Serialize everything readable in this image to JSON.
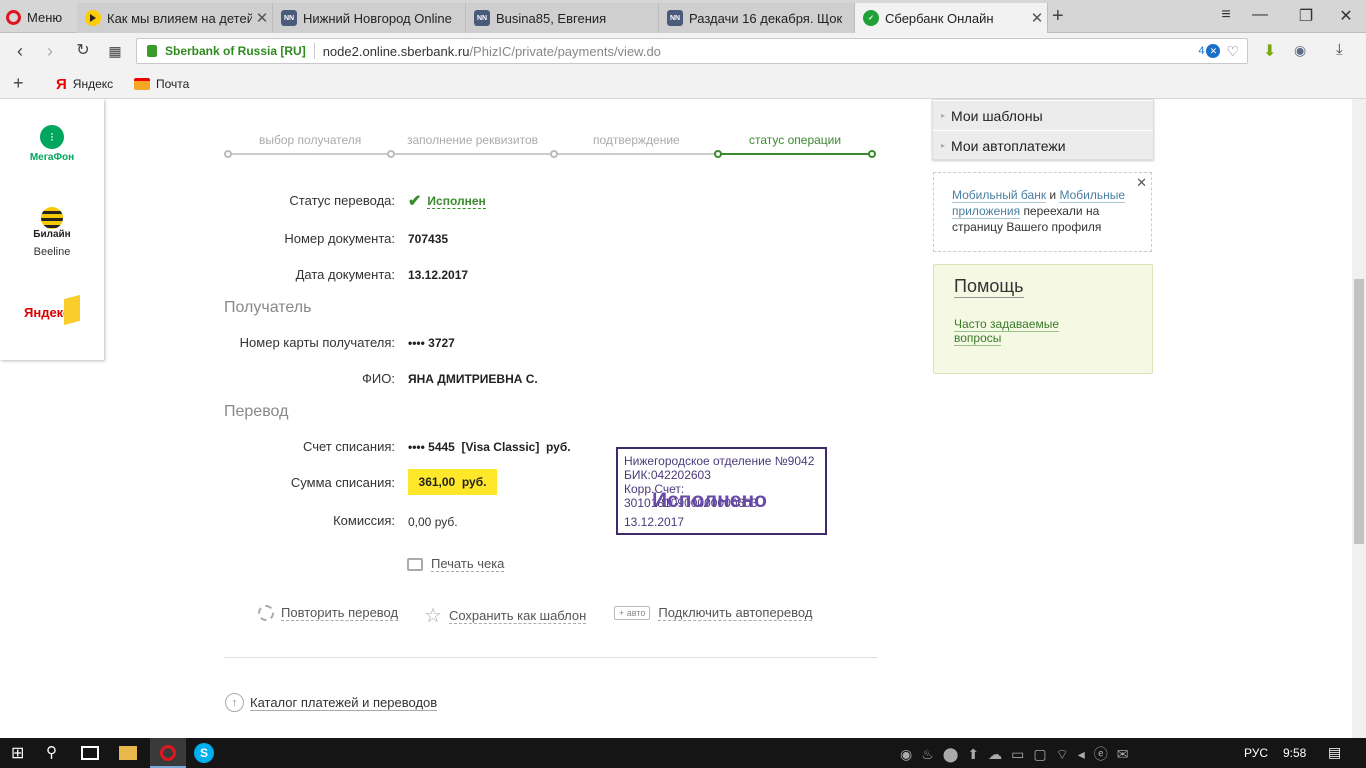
{
  "browser": {
    "menu_label": "Меню",
    "tabs": [
      {
        "title": "Как мы влияем на детей.",
        "favicon": "youtube-icon"
      },
      {
        "title": "Нижний Новгород Online",
        "favicon": "nn-icon"
      },
      {
        "title": "Busina85, Евгения",
        "favicon": "nn-icon"
      },
      {
        "title": "Раздачи 16 декабря. Щок",
        "favicon": "nn-icon"
      },
      {
        "title": "Сбербанк Онлайн",
        "favicon": "sberbank-icon"
      }
    ],
    "security_label": "Sberbank of Russia [RU]",
    "url_host": "node2.online.sberbank.ru",
    "url_path": "/PhizIC/private/payments/view.do",
    "tracker_count": "4",
    "bookmarks": [
      {
        "label": "Яндекс",
        "icon": "yandex-icon"
      },
      {
        "label": "Почта",
        "icon": "mail-icon"
      }
    ]
  },
  "sidebar": {
    "providers": [
      {
        "name": "МегаФон",
        "logo_text": "МегаФон",
        "color": "#00a65e"
      },
      {
        "name": "Beeline",
        "logo_text": "Билайн",
        "color": "#f7c800"
      },
      {
        "name": "Яндекс",
        "logo_text": "Яндекс",
        "color": "#f8cd2c"
      }
    ]
  },
  "steps": [
    {
      "label": "выбор получателя",
      "state": "done"
    },
    {
      "label": "заполнение реквизитов",
      "state": "done"
    },
    {
      "label": "подтверждение",
      "state": "done"
    },
    {
      "label": "статус операции",
      "state": "current"
    }
  ],
  "operation": {
    "status_label": "Статус перевода:",
    "status_value": "Исполнен",
    "doc_number_label": "Номер документа:",
    "doc_number": "707435",
    "doc_date_label": "Дата документа:",
    "doc_date": "13.12.2017",
    "recipient_header": "Получатель",
    "card_label": "Номер карты получателя:",
    "card_value": "•••• 3727",
    "fio_label": "ФИО:",
    "fio_value": "ЯНА ДМИТРИЕВНА С.",
    "transfer_header": "Перевод",
    "account_label": "Счет списания:",
    "account_value": "•••• 5445  [Visa Classic]  руб.",
    "amount_label": "Сумма списания:",
    "amount_value": "361,00  руб.",
    "fee_label": "Комиссия:",
    "fee_value": "0,00 руб.",
    "print_label": "Печать чека"
  },
  "stamp": {
    "line1": "Нижегородское отделение №9042",
    "line2": "БИК:042202603",
    "line3": "Корр.Счет: 30101810900000000603",
    "status": "Исполнено",
    "date": "13.12.2017"
  },
  "actions": {
    "repeat": "Повторить перевод",
    "save_template": "Сохранить как шаблон",
    "auto_badge": "авто",
    "autotransfer": "Подключить автоперевод",
    "catalog": "Каталог платежей и переводов"
  },
  "right": {
    "menu": [
      "Мои шаблоны",
      "Мои автоплатежи"
    ],
    "notice_link1": "Мобильный банк",
    "notice_and": "и",
    "notice_link2": "Мобильные приложения",
    "notice_text": "переехали на страницу Вашего профиля",
    "help_title": "Помощь",
    "help_link": "Часто задаваемые вопросы"
  },
  "taskbar": {
    "lang": "РУС",
    "time": "9:58"
  },
  "colors": {
    "sber_green": "#3a8a2e",
    "highlight": "#ffe82a",
    "stamp": "#3f2a6b"
  }
}
